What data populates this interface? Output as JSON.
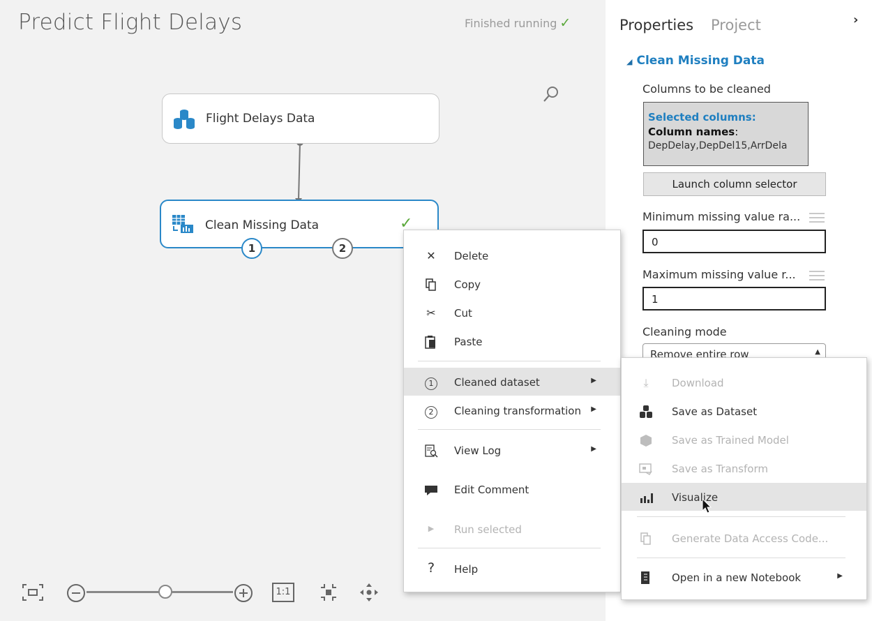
{
  "experiment": {
    "title": "Predict Flight Delays",
    "status": "Finished running"
  },
  "canvas": {
    "modules": [
      {
        "label": "Flight Delays Data"
      },
      {
        "label": "Clean Missing Data"
      }
    ],
    "ports": [
      "1",
      "2"
    ]
  },
  "zoom": {
    "actual_size_label": "1:1"
  },
  "panel": {
    "tabs": {
      "properties": "Properties",
      "project": "Project"
    },
    "section_title": "Clean Missing Data",
    "columns_label": "Columns to be cleaned",
    "selected_columns_label": "Selected columns:",
    "column_names_label": "Column names",
    "column_names_value": "DepDelay,DepDel15,ArrDela",
    "launch_button": "Launch column selector",
    "min_label": "Minimum missing value ra...",
    "min_value": "0",
    "max_label": "Maximum missing value r...",
    "max_value": "1",
    "cleaning_mode_label": "Cleaning mode",
    "cleaning_mode_value": "Remove entire row"
  },
  "context_menu": {
    "items": [
      {
        "label": "Delete",
        "icon": "delete-x-icon"
      },
      {
        "label": "Copy",
        "icon": "copy-icon"
      },
      {
        "label": "Cut",
        "icon": "scissors-icon"
      },
      {
        "label": "Paste",
        "icon": "paste-icon"
      },
      {
        "label": "Cleaned dataset",
        "icon": "port-1-icon",
        "port": "1"
      },
      {
        "label": "Cleaning transformation",
        "icon": "port-2-icon",
        "port": "2"
      },
      {
        "label": "View Log",
        "icon": "view-log-icon"
      },
      {
        "label": "Edit Comment",
        "icon": "comment-icon"
      },
      {
        "label": "Run selected",
        "icon": "play-icon"
      },
      {
        "label": "Help",
        "icon": "help-icon",
        "glyph": "?"
      }
    ]
  },
  "submenu": {
    "items": [
      {
        "label": "Download",
        "icon": "download-icon"
      },
      {
        "label": "Save as Dataset",
        "icon": "dataset-icon"
      },
      {
        "label": "Save as Trained Model",
        "icon": "trained-model-icon"
      },
      {
        "label": "Save as Transform",
        "icon": "transform-icon"
      },
      {
        "label": "Visualize",
        "icon": "bar-chart-icon"
      },
      {
        "label": "Generate Data Access Code...",
        "icon": "copy-code-icon"
      },
      {
        "label": "Open in a new Notebook",
        "icon": "notebook-icon"
      }
    ]
  },
  "colors": {
    "accent": "#1f7fc0",
    "module_selected_border": "#2a88c8",
    "success": "#5aa83a"
  }
}
